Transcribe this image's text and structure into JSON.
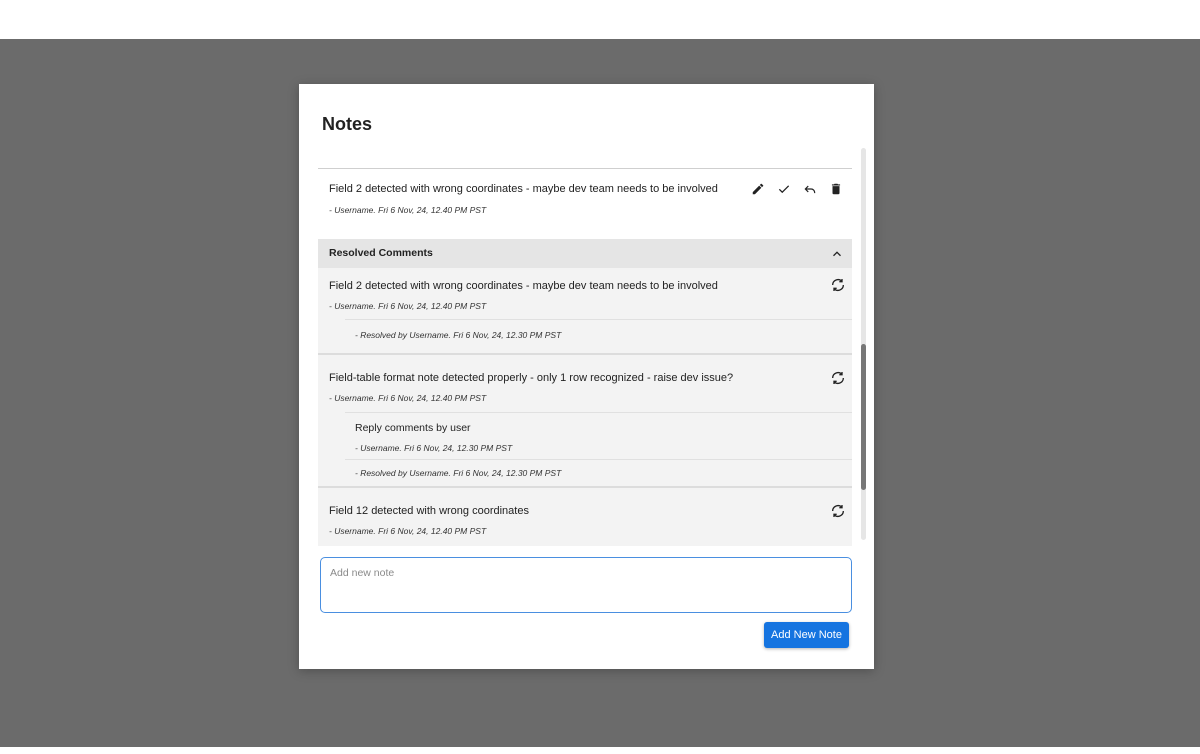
{
  "dialog": {
    "title": "Notes",
    "open_note": {
      "text": "Field 2 detected with wrong coordinates - maybe dev team needs to be involved",
      "meta": "- Username. Fri 6 Nov, 24, 12.40 PM PST",
      "actions": [
        "edit-icon",
        "check-icon",
        "reply-icon",
        "delete-icon"
      ]
    },
    "resolved_section": {
      "label": "Resolved Comments",
      "notes": [
        {
          "text": "Field 2 detected with wrong coordinates - maybe dev team needs to be involved",
          "meta": "- Username. Fri 6 Nov, 24, 12.40 PM PST",
          "resolved": "- Resolved by Username. Fri 6 Nov, 24, 12.30 PM PST"
        },
        {
          "text": "Field-table format note detected properly - only 1 row recognized - raise dev issue?",
          "meta": "- Username. Fri 6 Nov, 24, 12.40 PM PST",
          "reply_text": "Reply comments by user",
          "reply_meta": "- Username. Fri 6 Nov, 24, 12.30 PM PST",
          "resolved": "- Resolved by Username. Fri 6 Nov, 24, 12.30 PM PST"
        },
        {
          "text": "Field 12 detected with wrong coordinates",
          "meta": "- Username. Fri 6 Nov, 24, 12.40 PM PST"
        }
      ]
    },
    "input": {
      "placeholder": "Add new note",
      "value": ""
    },
    "add_button_label": "Add New Note"
  },
  "colors": {
    "overlay": "#6b6b6b",
    "accent": "#1574e0",
    "input_border": "#4a8fe0"
  }
}
